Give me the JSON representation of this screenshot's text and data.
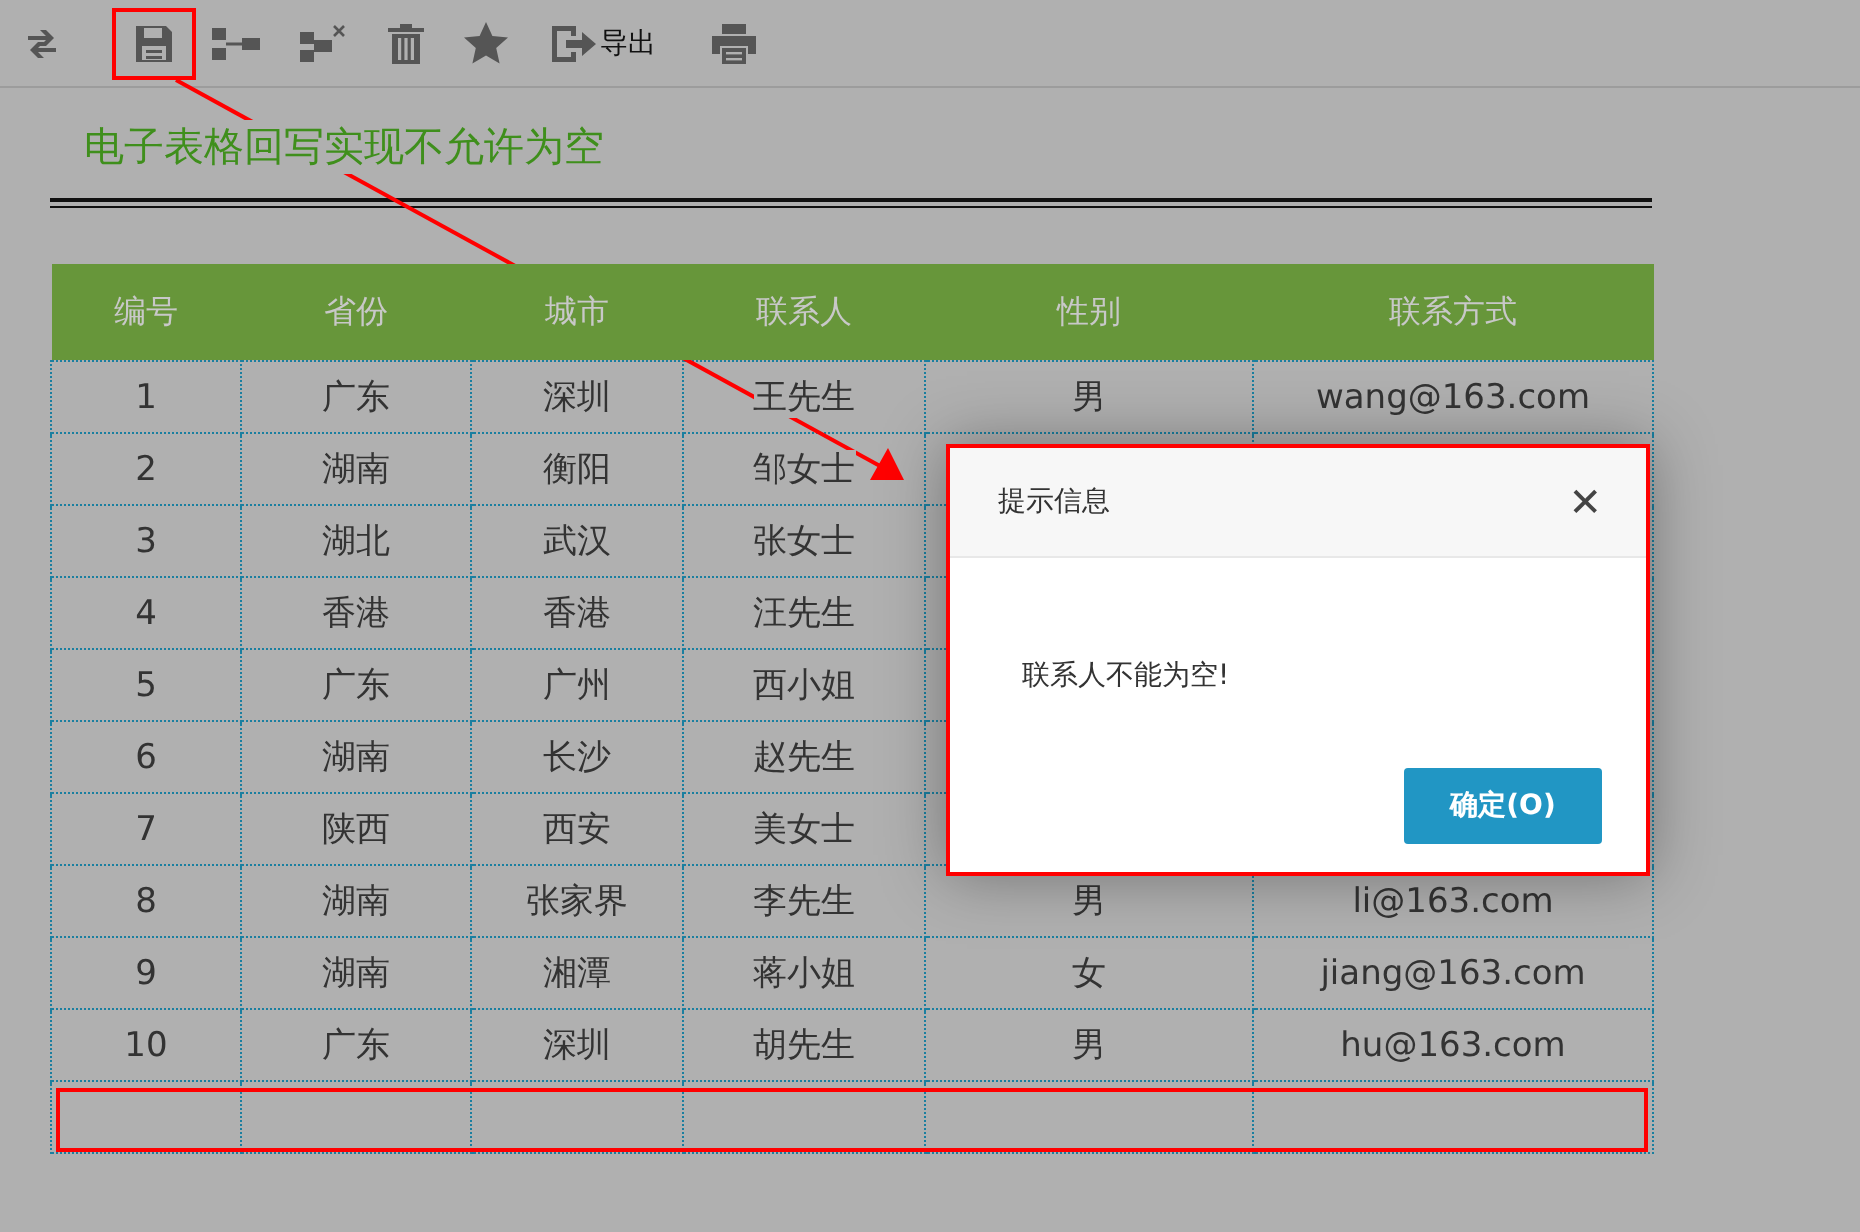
{
  "toolbar": {
    "export_label": "导出"
  },
  "title": "电子表格回写实现不允许为空",
  "table": {
    "columns": [
      "编号",
      "省份",
      "城市",
      "联系人",
      "性别",
      "联系方式"
    ],
    "rows": [
      {
        "cells": [
          "1",
          "广东",
          "深圳",
          "王先生",
          "男",
          "wang@163.com"
        ]
      },
      {
        "cells": [
          "2",
          "湖南",
          "衡阳",
          "邹女士"
        ]
      },
      {
        "cells": [
          "3",
          "湖北",
          "武汉",
          "张女士"
        ]
      },
      {
        "cells": [
          "4",
          "香港",
          "香港",
          "汪先生"
        ]
      },
      {
        "cells": [
          "5",
          "广东",
          "广州",
          "西小姐"
        ]
      },
      {
        "cells": [
          "6",
          "湖南",
          "长沙",
          "赵先生"
        ]
      },
      {
        "cells": [
          "7",
          "陕西",
          "西安",
          "美女士"
        ]
      },
      {
        "cells": [
          "8",
          "湖南",
          "张家界",
          "李先生",
          "男",
          "li@163.com"
        ]
      },
      {
        "cells": [
          "9",
          "湖南",
          "湘潭",
          "蒋小姐",
          "女",
          "jiang@163.com"
        ]
      },
      {
        "cells": [
          "10",
          "广东",
          "深圳",
          "胡先生",
          "男",
          "hu@163.com"
        ]
      },
      {
        "cells": []
      }
    ]
  },
  "dialog": {
    "title": "提示信息",
    "close": "✕",
    "message": "联系人不能为空!",
    "button": "确定(O)"
  },
  "annotation": {
    "highlight_save": true,
    "highlight_new_row": true,
    "highlight_dialog": true,
    "arrow": true
  }
}
